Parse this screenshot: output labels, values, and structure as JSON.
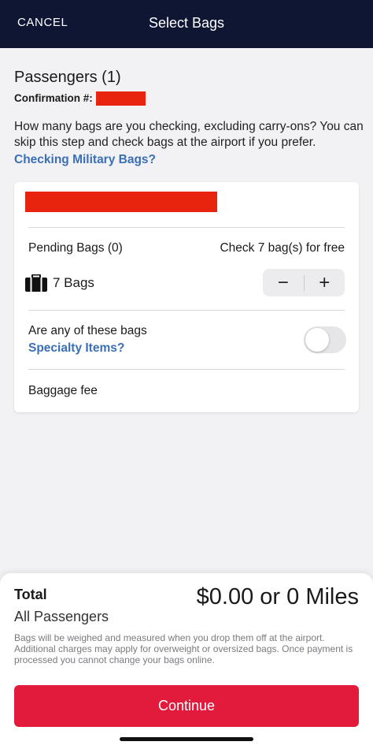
{
  "topbar": {
    "cancel": "CANCEL",
    "title": "Select Bags"
  },
  "passengers": {
    "title": "Passengers (1)",
    "confirmation_label": "Confirmation #:"
  },
  "intro_text": "How many bags are you checking, excluding carry-ons? You can skip this step and check bags at the airport if you prefer.",
  "military_link": "Checking Military Bags?",
  "card": {
    "pending_label": "Pending Bags (0)",
    "free_text": "Check 7 bag(s) for free",
    "bags_label": "7 Bags",
    "stepper": {
      "minus": "−",
      "plus": "+"
    },
    "specialty_question": "Are any of these bags",
    "specialty_link": "Specialty Items?",
    "specialty_toggle_on": false,
    "baggage_fee_label": "Baggage fee"
  },
  "footer": {
    "total_label": "Total",
    "all_passengers": "All Passengers",
    "total_value": "$0.00 or 0 Miles",
    "disclaimer": "Bags will be weighed and measured when you drop them off at the airport. Additional charges may apply for overweight or oversized bags. Once payment is processed you cannot change your bags online.",
    "continue_label": "Continue"
  },
  "colors": {
    "nav_bg": "#0f1634",
    "link": "#3a6fb6",
    "primary_button": "#e21b3c",
    "redaction": "#e8240e"
  }
}
